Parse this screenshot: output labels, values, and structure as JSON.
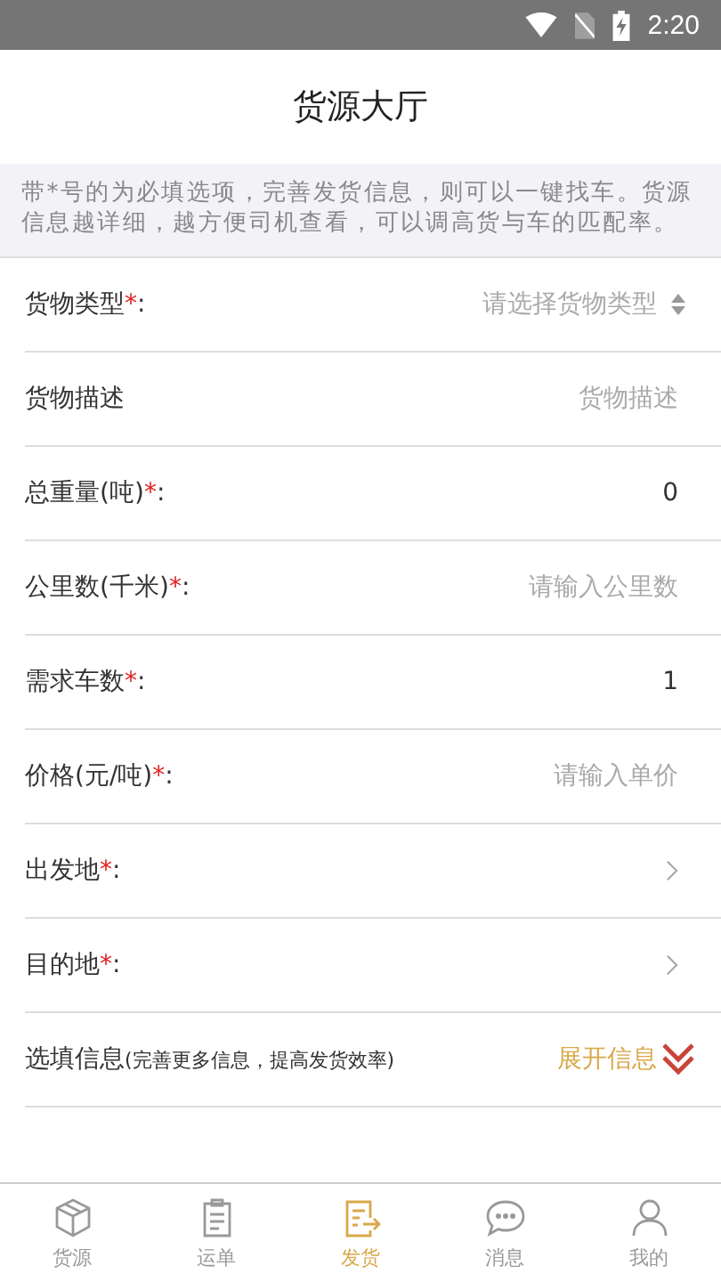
{
  "status_bar": {
    "time": "2:20"
  },
  "header": {
    "title": "货源大厅"
  },
  "notice": "带*号的为必填选项，完善发货信息，则可以一键找车。货源信息越详细，越方便司机查看，可以调高货与车的匹配率。",
  "fields": [
    {
      "kind": "select",
      "label": "货物类型",
      "mark": "*",
      "colon": ":",
      "placeholder": "请选择货物类型"
    },
    {
      "kind": "input",
      "label": "货物描述",
      "placeholder": "货物描述"
    },
    {
      "kind": "input",
      "label": "总重量(吨)",
      "mark": "*",
      "colon": ":",
      "value": "0"
    },
    {
      "kind": "input",
      "label": "公里数(千米)",
      "mark": "*",
      "colon": ":",
      "placeholder": "请输入公里数"
    },
    {
      "kind": "input",
      "label": "需求车数",
      "mark": "*",
      "colon": ":",
      "value": "1"
    },
    {
      "kind": "input",
      "label": "价格(元/吨)",
      "mark": "*",
      "colon": ":",
      "placeholder": "请输入单价"
    },
    {
      "kind": "nav",
      "label": "出发地",
      "mark": "*",
      "colon": ":"
    },
    {
      "kind": "nav",
      "label": "目的地",
      "mark": "*",
      "colon": ":"
    }
  ],
  "optional": {
    "label": "选填信息",
    "hint": "(完善更多信息，提高发货效率)",
    "toggle": "展开信息",
    "expanded": false
  },
  "tabs": [
    {
      "kind": "cube",
      "label": "货源",
      "selected": false
    },
    {
      "kind": "clipboard",
      "label": "运单",
      "selected": false
    },
    {
      "kind": "ship",
      "label": "发货",
      "selected": true
    },
    {
      "kind": "chat",
      "label": "消息",
      "selected": false
    },
    {
      "kind": "person",
      "label": "我的",
      "selected": false
    }
  ]
}
